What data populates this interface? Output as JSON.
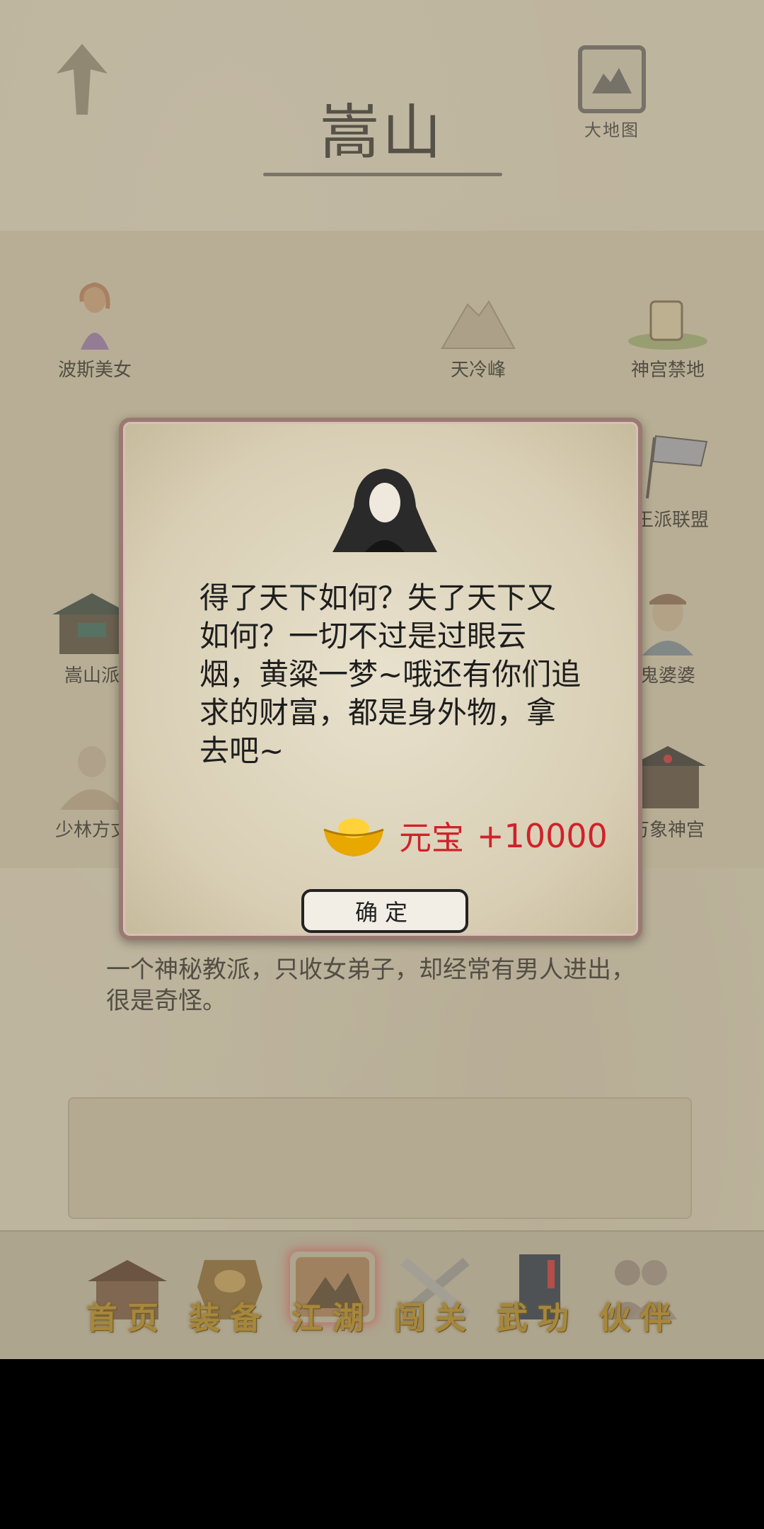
{
  "header": {
    "title": "嵩山",
    "map_button_label": "大地图"
  },
  "locations": [
    {
      "name": "波斯美女",
      "icon": "woman-icon"
    },
    {
      "name": "天冷峰",
      "icon": "mountain-icon"
    },
    {
      "name": "神宫禁地",
      "icon": "forbidden-stone-icon"
    },
    {
      "name": "王派联盟",
      "icon": "flag-icon"
    },
    {
      "name": "嵩山派",
      "icon": "temple-icon"
    },
    {
      "name": "鬼婆婆",
      "icon": "old-woman-icon"
    },
    {
      "name": "少林方丈",
      "icon": "monk-icon"
    },
    {
      "name": "万象神宫",
      "icon": "palace-icon"
    }
  ],
  "location_description": "一个神秘教派，只收女弟子，却经常有男人进出，很是奇怪。",
  "dialog": {
    "text": "得了天下如何？失了天下又如何？一切不过是过眼云烟，黄粱一梦~哦还有你们追求的财富，都是身外物，拿去吧~",
    "reward_name": "元宝",
    "reward_amount": "+10000",
    "confirm_label": "确定",
    "reward_color": "#d0222a"
  },
  "nav": {
    "items": [
      {
        "label": "首页",
        "icon": "house-icon"
      },
      {
        "label": "装备",
        "icon": "armor-icon"
      },
      {
        "label": "江湖",
        "icon": "scroll-map-icon"
      },
      {
        "label": "闯关",
        "icon": "swords-icon"
      },
      {
        "label": "武功",
        "icon": "book-icon"
      },
      {
        "label": "伙伴",
        "icon": "people-icon"
      }
    ],
    "active": "江湖"
  }
}
